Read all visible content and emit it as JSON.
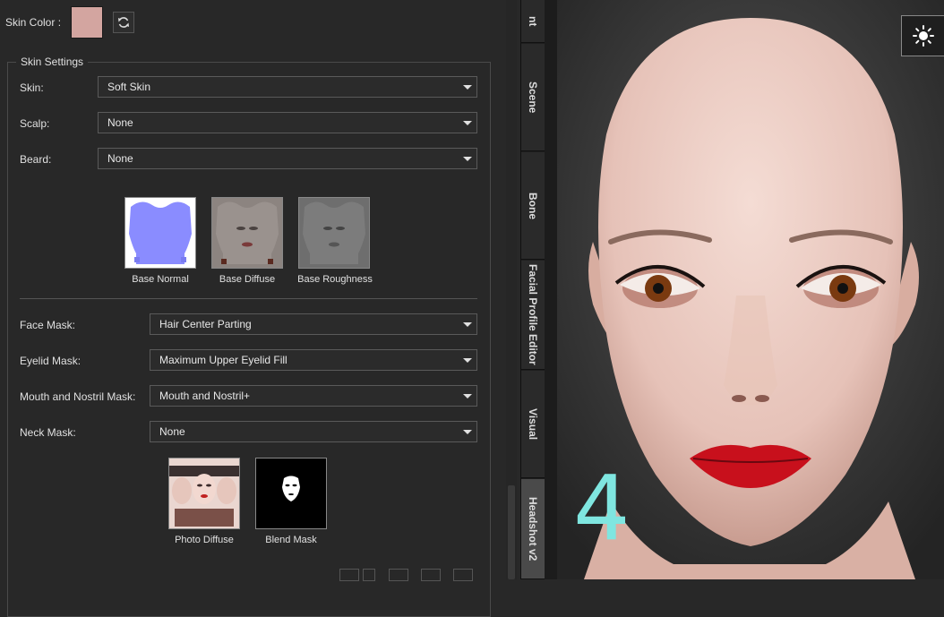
{
  "skin_color": {
    "label": "Skin Color :",
    "swatch_color": "#d3a5a0"
  },
  "skin_settings": {
    "title": "Skin Settings",
    "skin": {
      "label": "Skin:",
      "value": "Soft Skin"
    },
    "scalp": {
      "label": "Scalp:",
      "value": "None"
    },
    "beard": {
      "label": "Beard:",
      "value": "None"
    },
    "textures": [
      {
        "label": "Base Normal",
        "color": "#8a8cff"
      },
      {
        "label": "Base Diffuse",
        "color": "#8c8480"
      },
      {
        "label": "Base Roughness",
        "color": "#6e6e6e"
      }
    ],
    "face_mask": {
      "label": "Face Mask:",
      "value": "Hair Center Parting"
    },
    "eyelid_mask": {
      "label": "Eyelid Mask:",
      "value": "Maximum Upper Eyelid Fill"
    },
    "mouth_mask": {
      "label": "Mouth and Nostril Mask:",
      "value": "Mouth and Nostril+"
    },
    "neck_mask": {
      "label": "Neck Mask:",
      "value": "None"
    },
    "mask_textures": [
      {
        "label": "Photo Diffuse"
      },
      {
        "label": "Blend Mask"
      }
    ]
  },
  "tabs": [
    {
      "label": "nt"
    },
    {
      "label": "Scene"
    },
    {
      "label": "Bone"
    },
    {
      "label": "Facial Profile Editor"
    },
    {
      "label": "Visual"
    },
    {
      "label": "Headshot v2",
      "active": true
    }
  ],
  "viewport": {
    "overlay_number": "4",
    "overlay_color": "#7fe6e0"
  }
}
